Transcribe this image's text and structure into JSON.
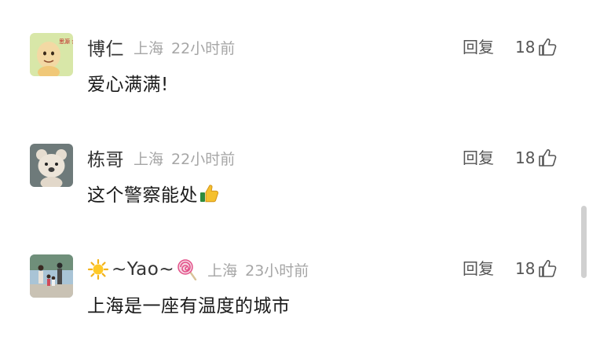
{
  "comments": [
    {
      "username": "博仁",
      "location": "上海",
      "time": "22小时前",
      "text": "爱心满满!",
      "reply_label": "回复",
      "likes": "18",
      "avatar_icon": "cartoon-baby-avatar",
      "avatar_text": "思源 会不会"
    },
    {
      "username": "栋哥",
      "location": "上海",
      "time": "22小时前",
      "text": "这个警察能处",
      "text_emoji": "thumbs-up-emoji",
      "reply_label": "回复",
      "likes": "18",
      "avatar_icon": "plush-bear-avatar"
    },
    {
      "username_prefix_emoji": "sun-emoji",
      "username": "~Yao~",
      "username_suffix_emoji": "lollipop-emoji",
      "location": "上海",
      "time": "23小时前",
      "text": "上海是一座有温度的城市",
      "reply_label": "回复",
      "likes": "18",
      "avatar_icon": "family-photo-avatar"
    }
  ],
  "colors": {
    "username": "#333333",
    "meta": "#a6a6a6",
    "text": "#1a1a1a",
    "action": "#555555"
  }
}
